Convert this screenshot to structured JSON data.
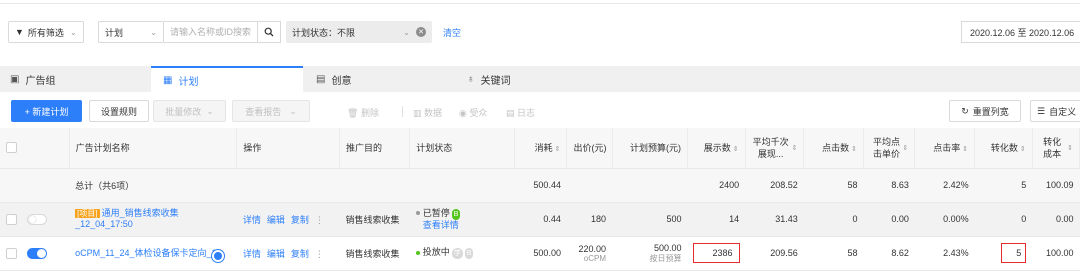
{
  "filterbar": {
    "all_filters_label": "所有筛选",
    "plan_select_label": "计划",
    "search_placeholder": "请输入名称或ID搜索",
    "status_chip_label": "计划状态：不限",
    "clear_label": "清空",
    "date_range": "2020.12.06 至 2020.12.06"
  },
  "tabs": [
    {
      "label": "广告组",
      "icon": "folder-icon"
    },
    {
      "label": "计划",
      "icon": "calendar-icon",
      "active": true
    },
    {
      "label": "创意",
      "icon": "image-icon"
    },
    {
      "label": "关键词",
      "icon": "tag-icon"
    }
  ],
  "toolbar": {
    "new_plan": "+ 新建计划",
    "set_rules": "设置规则",
    "batch_edit": "批量修改",
    "view_reports": "查看报告",
    "delete": "删除",
    "data": "数据",
    "audience": "受众",
    "log": "日志",
    "reset_columns": "重置列宽",
    "customize": "自定义"
  },
  "table": {
    "headers": {
      "name": "广告计划名称",
      "ops": "操作",
      "purpose": "推广目的",
      "status": "计划状态",
      "cost": "消耗",
      "bid": "出价(元)",
      "budget": "计划预算(元)",
      "impressions": "展示数",
      "cpm": "平均千次展现...",
      "clicks": "点击数",
      "cpc": "平均点击单价",
      "ctr": "点击率",
      "conversions": "转化数",
      "cpa": "转化成本"
    },
    "total": {
      "label": "总计（共6项）",
      "cost": "500.44",
      "impressions": "2400",
      "cpm": "208.52",
      "clicks": "58",
      "cpc": "8.63",
      "ctr": "2.42%",
      "conversions": "5",
      "cpa": "100.09"
    },
    "rows": [
      {
        "tag": "[项目]",
        "name": "通用_销售线索收集_12_04_17:50",
        "ops": [
          "详情",
          "编辑",
          "复制",
          "⋮"
        ],
        "purpose": "销售线索收集",
        "status": "已暂停",
        "status_badge": "B",
        "status_link": "查看详情",
        "cost": "0.44",
        "bid": "180",
        "budget": "500",
        "impressions": "14",
        "cpm": "31.43",
        "clicks": "0",
        "cpc": "0.00",
        "ctr": "0.00%",
        "conversions": "0",
        "cpa": "0.00"
      },
      {
        "name": "oCPM_11_24_体检设备保卡定向_1",
        "ops": [
          "详情",
          "编辑",
          "复制",
          "⋮"
        ],
        "purpose": "销售线索收集",
        "status": "投放中",
        "status_badge_a": "学",
        "status_badge_b": "B",
        "cost": "500.00",
        "bid": "220.00",
        "bid_sub": "oCPM",
        "budget": "500.00",
        "budget_sub": "按日预算",
        "impressions": "2386",
        "cpm": "209.56",
        "clicks": "58",
        "cpc": "8.62",
        "ctr": "2.43%",
        "conversions": "5",
        "cpa": "100.00"
      }
    ]
  },
  "colors": {
    "accent": "#2d7ff9",
    "highlight": "#e82b2b"
  }
}
